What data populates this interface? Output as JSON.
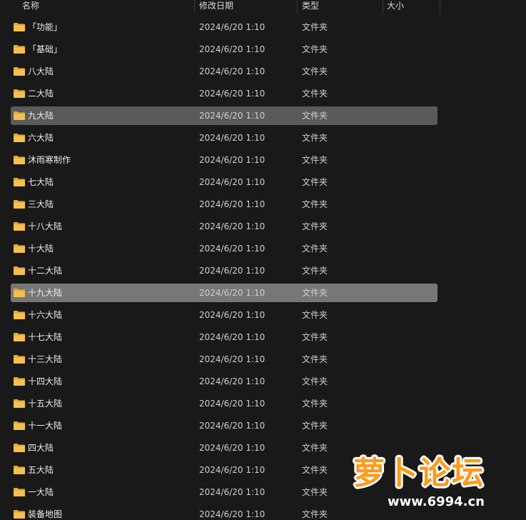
{
  "columns": {
    "name": "名称",
    "modified": "修改日期",
    "type": "类型",
    "size": "大小"
  },
  "rows": [
    {
      "name": "「功能」",
      "date": "2024/6/20 1:10",
      "type": "文件夹"
    },
    {
      "name": "「基础」",
      "date": "2024/6/20 1:10",
      "type": "文件夹"
    },
    {
      "name": "八大陆",
      "date": "2024/6/20 1:10",
      "type": "文件夹"
    },
    {
      "name": "二大陆",
      "date": "2024/6/20 1:10",
      "type": "文件夹"
    },
    {
      "name": "九大陆",
      "date": "2024/6/20 1:10",
      "type": "文件夹"
    },
    {
      "name": "六大陆",
      "date": "2024/6/20 1:10",
      "type": "文件夹"
    },
    {
      "name": "沐雨寒制作",
      "date": "2024/6/20 1:10",
      "type": "文件夹"
    },
    {
      "name": "七大陆",
      "date": "2024/6/20 1:10",
      "type": "文件夹"
    },
    {
      "name": "三大陆",
      "date": "2024/6/20 1:10",
      "type": "文件夹"
    },
    {
      "name": "十八大陆",
      "date": "2024/6/20 1:10",
      "type": "文件夹"
    },
    {
      "name": "十大陆",
      "date": "2024/6/20 1:10",
      "type": "文件夹"
    },
    {
      "name": "十二大陆",
      "date": "2024/6/20 1:10",
      "type": "文件夹"
    },
    {
      "name": "十九大陆",
      "date": "2024/6/20 1:10",
      "type": "文件夹"
    },
    {
      "name": "十六大陆",
      "date": "2024/6/20 1:10",
      "type": "文件夹"
    },
    {
      "name": "十七大陆",
      "date": "2024/6/20 1:10",
      "type": "文件夹"
    },
    {
      "name": "十三大陆",
      "date": "2024/6/20 1:10",
      "type": "文件夹"
    },
    {
      "name": "十四大陆",
      "date": "2024/6/20 1:10",
      "type": "文件夹"
    },
    {
      "name": "十五大陆",
      "date": "2024/6/20 1:10",
      "type": "文件夹"
    },
    {
      "name": "十一大陆",
      "date": "2024/6/20 1:10",
      "type": "文件夹"
    },
    {
      "name": "四大陆",
      "date": "2024/6/20 1:10",
      "type": "文件夹"
    },
    {
      "name": "五大陆",
      "date": "2024/6/20 1:10",
      "type": "文件夹"
    },
    {
      "name": "一大陆",
      "date": "2024/6/20 1:10",
      "type": "文件夹"
    },
    {
      "name": "装备地图",
      "date": "2024/6/20 1:10",
      "type": "文件夹"
    }
  ],
  "selected_rows": [
    "九大陆",
    "十九大陆"
  ],
  "focused_row": "十九大陆",
  "watermark": {
    "title": "萝卜论坛",
    "url": "www.6994.cn"
  },
  "colors": {
    "background": "#191919",
    "selected": "#5a5a5a",
    "focused": "#777777",
    "folder": "#f4c04e",
    "watermark": "#ff9a1a"
  }
}
